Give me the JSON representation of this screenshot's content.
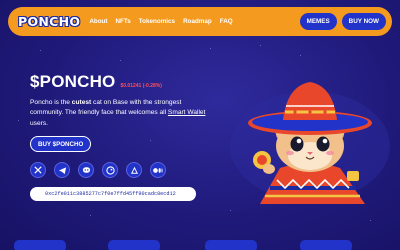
{
  "nav": {
    "logo": "PONCHO",
    "links": [
      "About",
      "NFTs",
      "Tokenomics",
      "Roadmap",
      "FAQ"
    ],
    "memes_label": "MEMES",
    "buy_now_label": "BUY NOW"
  },
  "hero": {
    "ticker": "$PONCHO",
    "price": "$0.01241 (-0.28%)",
    "desc_pre": "Poncho is the ",
    "desc_bold": "cutest",
    "desc_mid": " cat on Base with the strongest community. The friendly face that welcomes all ",
    "desc_link": "Smart Wallet",
    "desc_post": " users.",
    "buy_label": "BUY $PONCHO",
    "contract": "0xc2fe011c3885277c7f0e7ffd45ff90cadc8ecd12"
  },
  "socials": [
    "x-icon",
    "telegram-icon",
    "discord-icon",
    "coingecko-icon",
    "dexscreener-icon",
    "medium-icon"
  ],
  "colors": {
    "accent": "#f39a1f",
    "primary": "#2233c9",
    "background": "#1f1a7a",
    "price_down": "#ff4d5a"
  }
}
